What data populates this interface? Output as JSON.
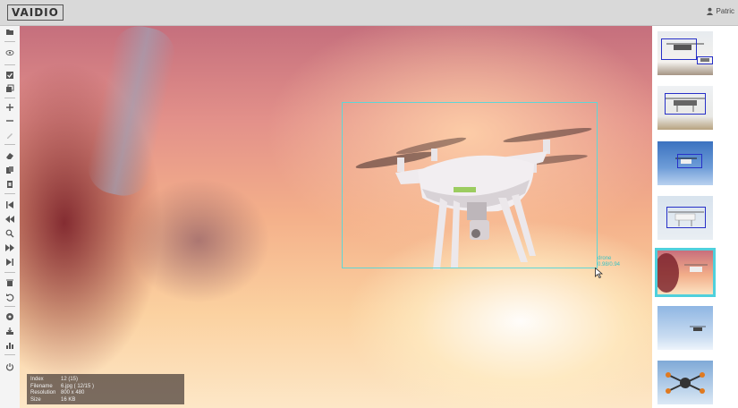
{
  "app": {
    "logo_text": "VAIDIO",
    "user_label": "Patric"
  },
  "toolbar": {
    "icons": [
      "folder-icon",
      "eye-icon",
      "checkbox-icon",
      "copy-icon",
      "add-icon",
      "remove-icon",
      "pen-icon",
      "eraser-icon",
      "copy-boxes-icon",
      "paste-boxes-icon",
      "skip-first-icon",
      "rewind-icon",
      "search-icon",
      "fast-forward-icon",
      "skip-last-icon",
      "delete-icon",
      "undo-icon",
      "model-icon",
      "export-icon",
      "chart-icon",
      "power-icon"
    ]
  },
  "annotation": {
    "label_line1": "drone",
    "label_line2": "0.98/0.94"
  },
  "info": {
    "rows": [
      {
        "key": "Index",
        "value": "12 (15)"
      },
      {
        "key": "Filename",
        "value": "6.jpg ( 12/15 )"
      },
      {
        "key": "Resolution",
        "value": "800 x 480"
      },
      {
        "key": "Size",
        "value": "16 KB"
      }
    ]
  },
  "thumbnails": {
    "selected_index": 4,
    "count": 7
  },
  "colors": {
    "bbox": "#5fd6d6",
    "thumb_selected": "#4fd0dc",
    "thumb_box": "#2730c8"
  }
}
